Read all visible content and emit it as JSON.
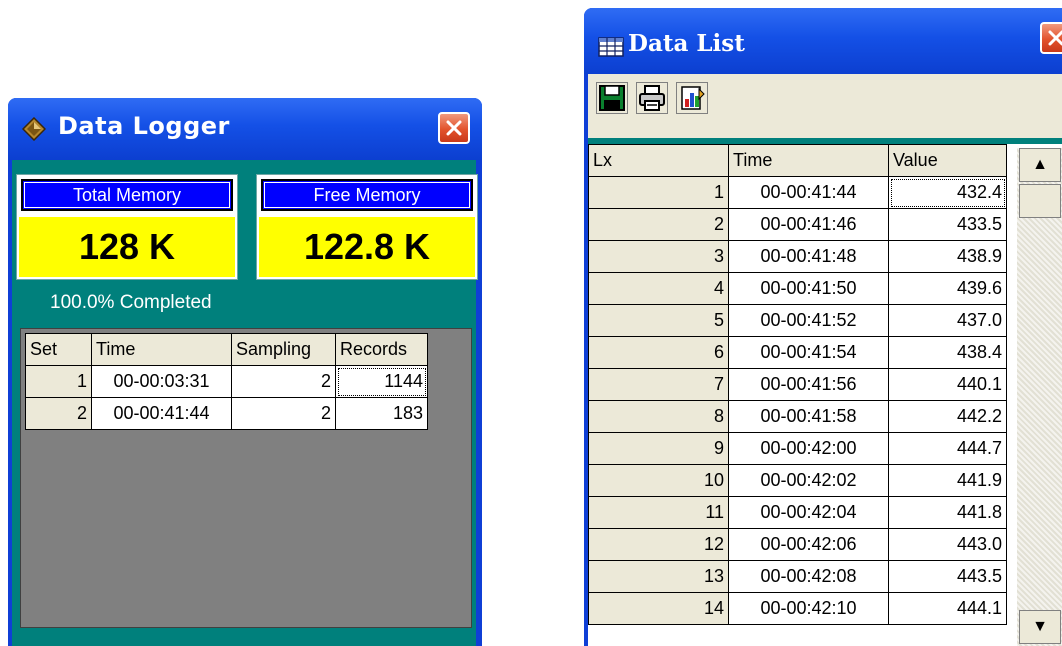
{
  "data_logger": {
    "title": "Data Logger",
    "icon": "diamond-logger-icon",
    "total_memory": {
      "label": "Total Memory",
      "value": "128 K"
    },
    "free_memory": {
      "label": "Free Memory",
      "value": "122.8 K"
    },
    "status": "100.0% Completed",
    "table": {
      "columns": [
        "Set",
        "Time",
        "Sampling",
        "Records"
      ],
      "rows": [
        {
          "set": "1",
          "time": "00-00:03:31",
          "sampling": "2",
          "records": "1144"
        },
        {
          "set": "2",
          "time": "00-00:41:44",
          "sampling": "2",
          "records": "183"
        }
      ]
    }
  },
  "data_list": {
    "title": "Data List",
    "icon": "grid-table-icon",
    "toolbar": [
      "save-disk-icon",
      "printer-icon",
      "chart-icon"
    ],
    "table": {
      "columns": [
        "Lx",
        "Time",
        "Value"
      ],
      "rows": [
        {
          "lx": "1",
          "time": "00-00:41:44",
          "value": "432.4"
        },
        {
          "lx": "2",
          "time": "00-00:41:46",
          "value": "433.5"
        },
        {
          "lx": "3",
          "time": "00-00:41:48",
          "value": "438.9"
        },
        {
          "lx": "4",
          "time": "00-00:41:50",
          "value": "439.6"
        },
        {
          "lx": "5",
          "time": "00-00:41:52",
          "value": "437.0"
        },
        {
          "lx": "6",
          "time": "00-00:41:54",
          "value": "438.4"
        },
        {
          "lx": "7",
          "time": "00-00:41:56",
          "value": "440.1"
        },
        {
          "lx": "8",
          "time": "00-00:41:58",
          "value": "442.2"
        },
        {
          "lx": "9",
          "time": "00-00:42:00",
          "value": "444.7"
        },
        {
          "lx": "10",
          "time": "00-00:42:02",
          "value": "441.9"
        },
        {
          "lx": "11",
          "time": "00-00:42:04",
          "value": "441.8"
        },
        {
          "lx": "12",
          "time": "00-00:42:06",
          "value": "443.0"
        },
        {
          "lx": "13",
          "time": "00-00:42:08",
          "value": "443.5"
        },
        {
          "lx": "14",
          "time": "00-00:42:10",
          "value": "444.1"
        }
      ]
    }
  },
  "colors": {
    "title_bar": "#1450e6",
    "panel_teal": "#00807c",
    "memory_label_bg": "#0000ff",
    "memory_value_bg": "#ffff00",
    "close_button": "#e2532c"
  }
}
